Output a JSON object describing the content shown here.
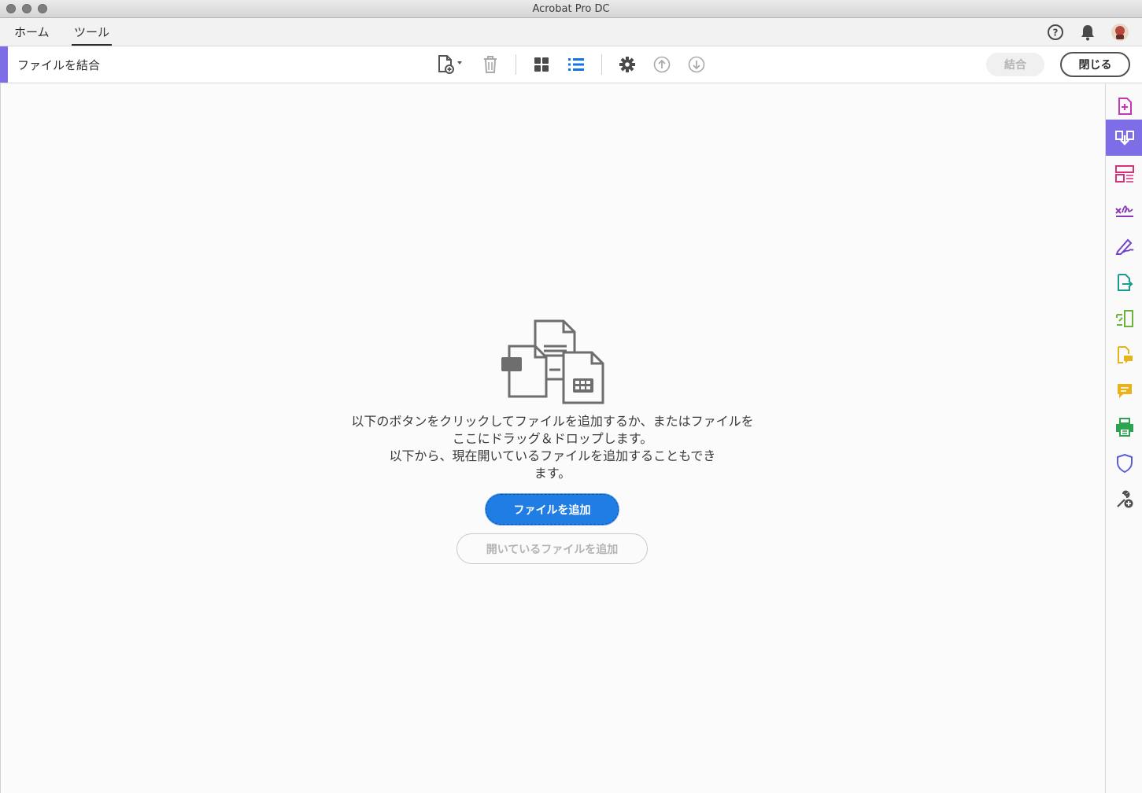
{
  "window": {
    "title": "Acrobat Pro DC"
  },
  "nav": {
    "tabs": [
      {
        "label": "ホーム",
        "active": false
      },
      {
        "label": "ツール",
        "active": true
      }
    ],
    "icons": [
      "help-icon",
      "bell-icon",
      "avatar"
    ]
  },
  "toolbar": {
    "tool_name": "ファイルを結合",
    "icons": [
      "add-file-dropdown-icon",
      "trash-icon",
      "grid-view-icon",
      "list-view-icon",
      "gear-icon",
      "move-up-icon",
      "move-down-icon"
    ],
    "combine_label": "結合",
    "close_label": "閉じる"
  },
  "main": {
    "instructions": [
      "以下のボタンをクリックしてファイルを追加するか、またはファイルを",
      "ここにドラッグ＆ドロップします。",
      "以下から、現在開いているファイルを追加することもでき",
      "ます。"
    ],
    "add_files_label": "ファイルを追加",
    "add_open_files_label": "開いているファイルを追加"
  },
  "right_rail": {
    "items": [
      {
        "icon": "create-pdf-icon",
        "color": "#c536b4"
      },
      {
        "icon": "combine-files-icon",
        "color": "#ffffff",
        "active": true
      },
      {
        "icon": "organize-pages-icon",
        "color": "#d6317a"
      },
      {
        "icon": "fill-sign-icon",
        "color": "#8a3ab9"
      },
      {
        "icon": "send-for-signature-icon",
        "color": "#7043c8"
      },
      {
        "icon": "export-pdf-icon",
        "color": "#1a9b8e"
      },
      {
        "icon": "edit-pdf-icon",
        "color": "#6cb33e"
      },
      {
        "icon": "send-for-comments-icon",
        "color": "#e8b21b"
      },
      {
        "icon": "comment-icon",
        "color": "#e8b21b"
      },
      {
        "icon": "print-production-icon",
        "color": "#2aa44f"
      },
      {
        "icon": "protect-icon",
        "color": "#5b5fd6"
      },
      {
        "icon": "more-tools-icon",
        "color": "#505050"
      }
    ]
  },
  "colors": {
    "accent": "#7d6ee8",
    "primary_button": "#1f7de3"
  }
}
